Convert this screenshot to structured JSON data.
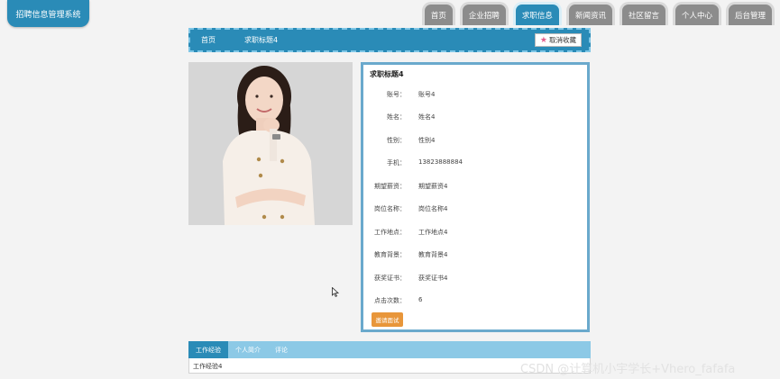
{
  "app": {
    "logo_text": "招聘信息管理系统"
  },
  "nav": {
    "tabs": [
      {
        "label": "首页",
        "active": false
      },
      {
        "label": "企业招聘",
        "active": false
      },
      {
        "label": "求职信息",
        "active": true
      },
      {
        "label": "新闻资讯",
        "active": false
      },
      {
        "label": "社区留言",
        "active": false
      },
      {
        "label": "个人中心",
        "active": false
      },
      {
        "label": "后台管理",
        "active": false
      }
    ]
  },
  "breadcrumb": {
    "home": "首页",
    "current": "求职标题4"
  },
  "actions": {
    "unfavorite_label": "取消收藏",
    "apply_label": "邀请面试"
  },
  "detail": {
    "title": "求职标题4",
    "fields": [
      {
        "label": "账号：",
        "value": "账号4"
      },
      {
        "label": "姓名：",
        "value": "姓名4"
      },
      {
        "label": "性别：",
        "value": "性别4"
      },
      {
        "label": "手机：",
        "value": "13823888884"
      },
      {
        "label": "期望薪资：",
        "value": "期望薪资4"
      },
      {
        "label": "岗位名称：",
        "value": "岗位名称4"
      },
      {
        "label": "工作地点：",
        "value": "工作地点4"
      },
      {
        "label": "教育背景：",
        "value": "教育背景4"
      },
      {
        "label": "获奖证书：",
        "value": "获奖证书4"
      },
      {
        "label": "点击次数：",
        "value": "6"
      }
    ]
  },
  "bottom_tabs": [
    {
      "label": "工作经验",
      "active": true
    },
    {
      "label": "个人简介",
      "active": false
    },
    {
      "label": "评论",
      "active": false
    }
  ],
  "bottom_content": "工作经验4",
  "watermark": "CSDN @计算机小宇学长+Vhero_fafafa",
  "colors": {
    "primary": "#2a8bb7",
    "tab_inactive": "#8c8c8c",
    "accent": "#e8963a"
  }
}
